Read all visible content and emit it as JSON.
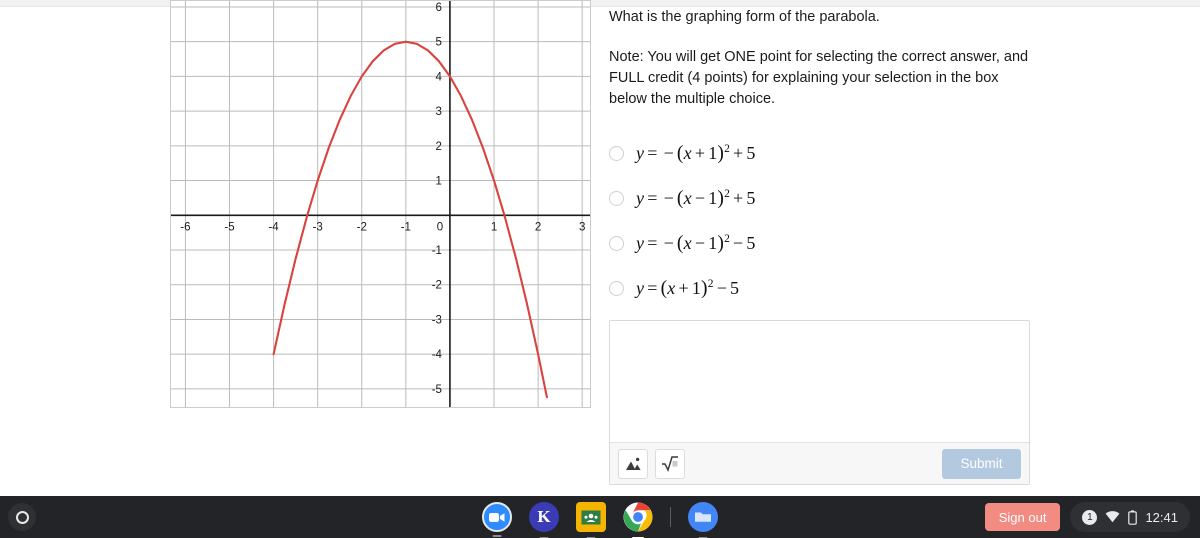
{
  "question": {
    "prompt": "What is the graphing form of the parabola.",
    "note": "Note: You will get ONE point for selecting the correct answer, and FULL credit (4 points) for explaining your selection in the box below the multiple choice.",
    "choices": [
      {
        "id": "a",
        "lhs": "y",
        "eq": "=",
        "sign": "−",
        "inner": "x + 1",
        "exp": "2",
        "tail_op": "+",
        "tail": "5",
        "text": "y = −(x + 1)² + 5",
        "selected": false
      },
      {
        "id": "b",
        "lhs": "y",
        "eq": "=",
        "sign": "−",
        "inner": "x − 1",
        "exp": "2",
        "tail_op": "+",
        "tail": "5",
        "text": "y = −(x − 1)² + 5",
        "selected": false
      },
      {
        "id": "c",
        "lhs": "y",
        "eq": "=",
        "sign": "−",
        "inner": "x − 1",
        "exp": "2",
        "tail_op": "−",
        "tail": "5",
        "text": "y = −(x − 1)² − 5",
        "selected": false
      },
      {
        "id": "d",
        "lhs": "y",
        "eq": "=",
        "sign": "",
        "inner": "x + 1",
        "exp": "2",
        "tail_op": "−",
        "tail": "5",
        "text": "y = (x + 1)² − 5",
        "selected": false
      }
    ]
  },
  "answer_box": {
    "value": "",
    "placeholder": "",
    "image_tool_label": "insert-image",
    "math_tool_label": "insert-equation",
    "submit_label": "Submit",
    "submit_color": "#b3c9e0"
  },
  "chart_data": {
    "type": "line",
    "title": "",
    "xlabel": "",
    "ylabel": "",
    "xlim": [
      -6.35,
      3.2
    ],
    "ylim": [
      -5.55,
      6.2
    ],
    "xticks": [
      -6,
      -5,
      -4,
      -3,
      -2,
      -1,
      0,
      1,
      2,
      3
    ],
    "yticks": [
      6,
      5,
      4,
      3,
      2,
      1,
      0,
      -1,
      -2,
      -3,
      -4,
      -5
    ],
    "grid": true,
    "legend": "none",
    "curve_color": "#d9433f",
    "axis_color": "#1a1a1a",
    "grid_color": "#bbbbbb",
    "equation": "y = -(x + 1)^2 + 5",
    "vertex": [
      -1,
      5
    ],
    "opens": "down",
    "y_intercept": 4,
    "x_intercepts": [
      -3.236,
      1.236
    ],
    "series": [
      {
        "name": "parabola",
        "points": [
          [
            -4.0,
            -4.0
          ],
          [
            -3.75,
            -2.5625
          ],
          [
            -3.5,
            -1.25
          ],
          [
            -3.236,
            0.0
          ],
          [
            -3.0,
            1.0
          ],
          [
            -2.75,
            1.9375
          ],
          [
            -2.5,
            2.75
          ],
          [
            -2.25,
            3.4375
          ],
          [
            -2.0,
            4.0
          ],
          [
            -1.75,
            4.4375
          ],
          [
            -1.5,
            4.75
          ],
          [
            -1.25,
            4.9375
          ],
          [
            -1.0,
            5.0
          ],
          [
            -0.75,
            4.9375
          ],
          [
            -0.5,
            4.75
          ],
          [
            -0.25,
            4.4375
          ],
          [
            0.0,
            4.0
          ],
          [
            0.25,
            3.4375
          ],
          [
            0.5,
            2.75
          ],
          [
            0.75,
            1.9375
          ],
          [
            1.0,
            1.0
          ],
          [
            1.236,
            0.0
          ],
          [
            1.5,
            -1.25
          ],
          [
            1.75,
            -2.5625
          ],
          [
            2.0,
            -4.0
          ],
          [
            2.2,
            -5.24
          ]
        ]
      }
    ]
  },
  "shelf": {
    "launcher_label": "launcher",
    "apps": [
      {
        "name": "zoom",
        "label": "Zoom",
        "glyph": "▶",
        "active": false
      },
      {
        "name": "kami",
        "label": "Kami",
        "glyph": "K",
        "active": false
      },
      {
        "name": "google-classroom",
        "label": "Google Classroom",
        "glyph": "",
        "active": false
      },
      {
        "name": "chrome",
        "label": "Chrome",
        "glyph": "",
        "active": true
      },
      {
        "name": "files",
        "label": "Files",
        "glyph": "",
        "active": false
      }
    ],
    "sign_out_label": "Sign out",
    "sign_out_color": "#f28b82",
    "notification_count": "1",
    "time": "12:41"
  }
}
